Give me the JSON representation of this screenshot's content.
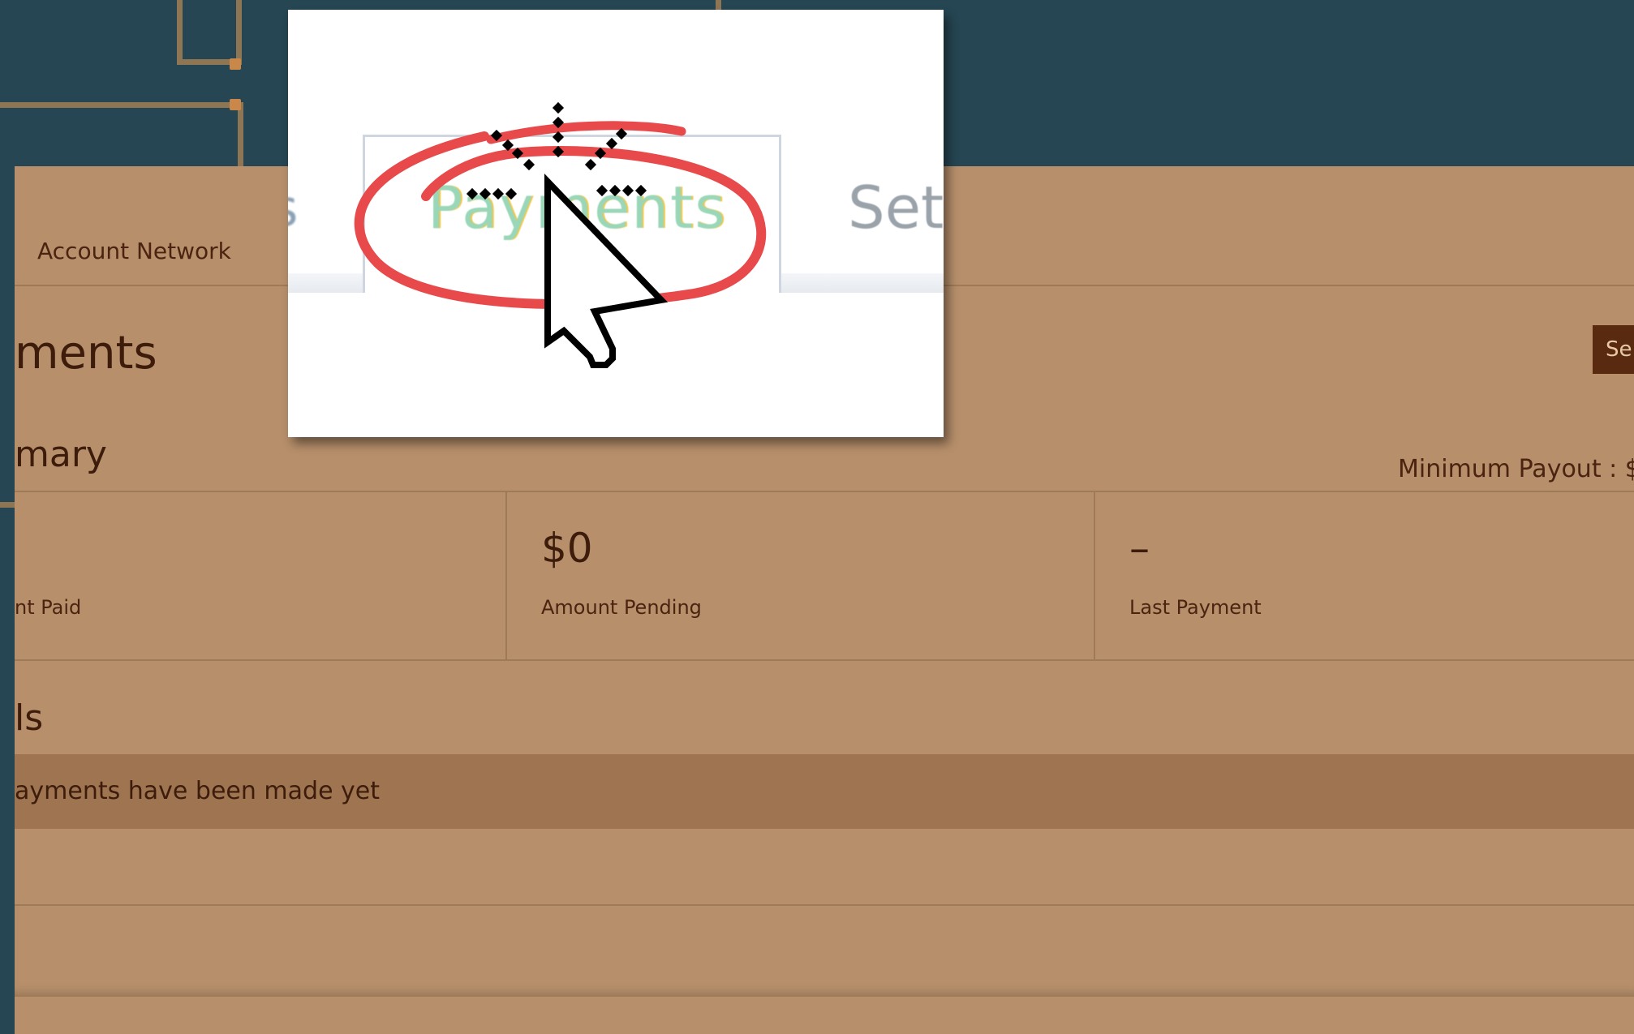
{
  "nav": {
    "tab_label": "Account Network"
  },
  "page": {
    "title": "ments",
    "top_button": "Se"
  },
  "summary": {
    "title": "mary",
    "min_payout": "Minimum Payout : $",
    "stats": [
      {
        "value": "",
        "label": "nt Paid"
      },
      {
        "value": "$0",
        "label": "Amount Pending"
      },
      {
        "value": "–",
        "label": "Last Payment"
      }
    ]
  },
  "details": {
    "title": "ls",
    "empty_text": "ayments have been made yet"
  },
  "zoom": {
    "prev_tab": "s",
    "current_tab": "Payments",
    "next_tab": "Set"
  },
  "colors": {
    "page_background": "#264653",
    "panel": "#b78f6b",
    "highlight_circle": "#e8494b",
    "active_tab_text": "#9ad7b8"
  },
  "icons": [
    "mouse-pointer-click-icon"
  ]
}
